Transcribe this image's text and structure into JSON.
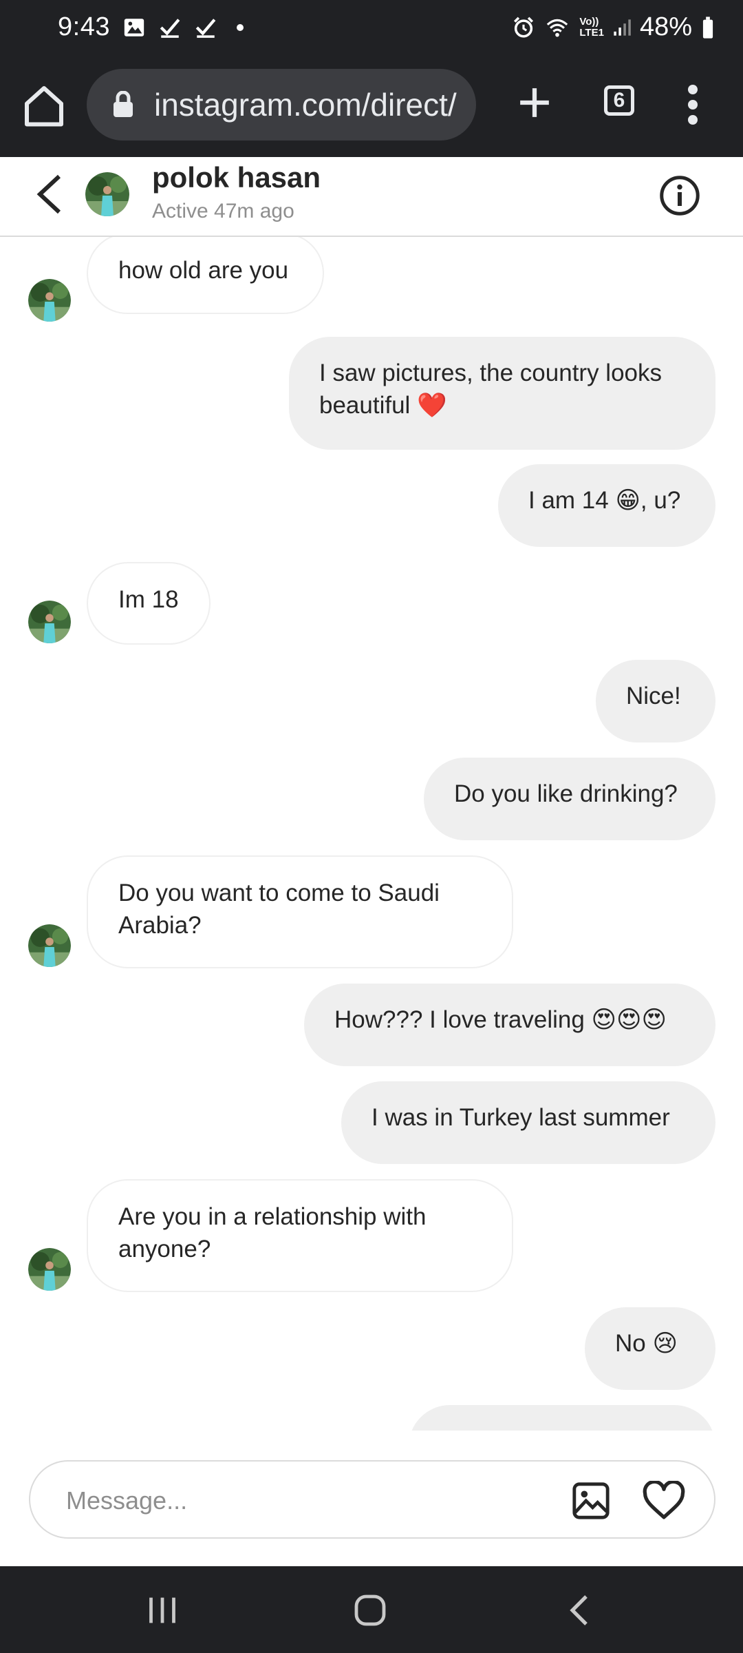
{
  "status_bar": {
    "time": "9:43",
    "battery": "48%",
    "left_icons": [
      "gallery-icon",
      "check-icon",
      "check-icon",
      "dot-icon"
    ],
    "right_icons": [
      "alarm-icon",
      "wifi-icon",
      "volte-icon",
      "signal-icon",
      "battery-icon"
    ],
    "volte_label": "Vo))",
    "lte_label": "LTE1"
  },
  "browser": {
    "url": "instagram.com/direct/",
    "tab_count": "6"
  },
  "chat": {
    "name": "polok hasan",
    "status": "Active 47m ago"
  },
  "messages": [
    {
      "from": "them",
      "text": "how old are you"
    },
    {
      "from": "me",
      "text": "I saw pictures, the country looks beautiful ❤️"
    },
    {
      "from": "me",
      "text": "I am 14 😁, u?"
    },
    {
      "from": "them",
      "text": "Im 18"
    },
    {
      "from": "me",
      "text": "Nice!"
    },
    {
      "from": "me",
      "text": "Do you like drinking?"
    },
    {
      "from": "them",
      "text": "Do you want to come to Saudi Arabia?"
    },
    {
      "from": "me",
      "text": "How??? I love traveling 😍😍😍"
    },
    {
      "from": "me",
      "text": "I was in Turkey last summer"
    },
    {
      "from": "them",
      "text": "Are you in a relationship with anyone?"
    },
    {
      "from": "me",
      "text": "No 😢"
    }
  ],
  "composer": {
    "placeholder": "Message..."
  },
  "colors": {
    "system_bar": "#202124",
    "url_field": "#3c3d41",
    "outgoing_bubble": "#efefef",
    "incoming_border": "#efefef",
    "secondary_text": "#8e8e8e"
  }
}
